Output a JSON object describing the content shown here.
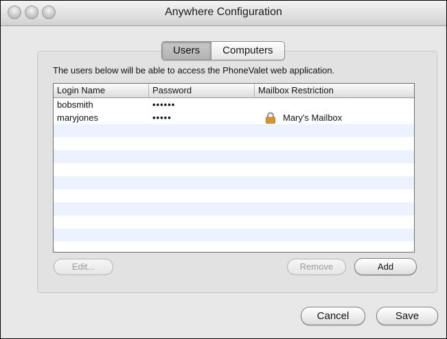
{
  "window": {
    "title": "Anywhere Configuration"
  },
  "tabs": [
    {
      "label": "Users",
      "active": true
    },
    {
      "label": "Computers",
      "active": false
    }
  ],
  "description": "The users below will be able to access the PhoneValet web application.",
  "table": {
    "columns": [
      "Login Name",
      "Password",
      "Mailbox Restriction"
    ],
    "rows": [
      {
        "login": "bobsmith",
        "password": "••••••",
        "mailbox": "",
        "locked": false
      },
      {
        "login": "maryjones",
        "password": "•••••",
        "mailbox": "Mary's Mailbox",
        "locked": true
      }
    ],
    "row_stripe_color": "#edf3fe"
  },
  "buttons": {
    "edit": "Edit...",
    "remove": "Remove",
    "add": "Add",
    "cancel": "Cancel",
    "save": "Save"
  }
}
